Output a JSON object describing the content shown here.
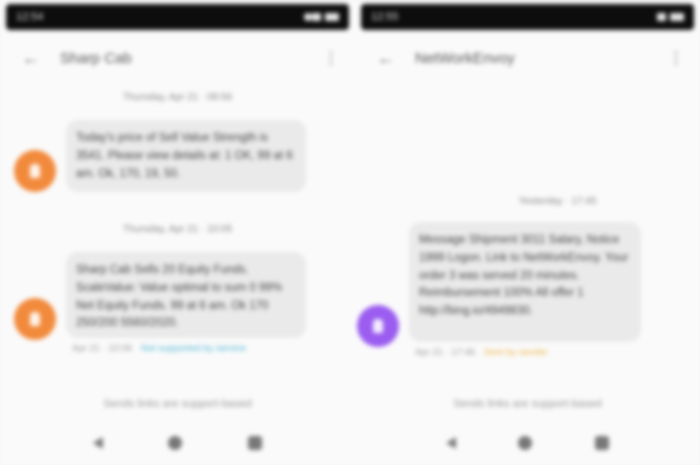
{
  "colors": {
    "statusbar_bg": "#0d0d0d",
    "bubble_bg": "#eaeaea",
    "avatar_left": "#f28a3c",
    "avatar_right": "#9b5cf0",
    "link_left": "#4fb6d6",
    "link_right": "#f0b64a"
  },
  "left": {
    "status_time": "12:54",
    "title": "Sharp Cab",
    "date_1": "Thursday, Apr 21 · 09:56",
    "message_1": "Today's price of Sell Value Strength is 3541. Please view details at: 1 OK, 99 at 6 am. Ok, 170, 19, 50.",
    "date_2": "Thursday, Apr 21 · 10:05",
    "message_2": "Sharp Cab Sells 20 Equity Funds. ScaleValue: Value optimal to sum 0 99% Net Equity Funds. 99 at 6 am. Ok 170 250/200 5560/2020.",
    "meta_time": "Apr 21 · 10:06",
    "meta_link": "Not supported by service",
    "composer": "Sends links are support-based"
  },
  "right": {
    "status_time": "12:55",
    "title": "NetWorkEnvoy",
    "date_1": "Yesterday · 17:45",
    "message_1": "Message Shipment 3011 Salary, Notice 1999 Logon. Link to NetWorkEnvoy. Your order 3 was served 20 minutes. Reimbursement 100% All offer 1 http://bing.io/4949830.",
    "meta_time": "Apr 21 · 17:46",
    "meta_link": "Sent by sender",
    "composer": "Sends links are support-based"
  },
  "icons": {
    "back": "arrow-left-icon",
    "more": "more-vert-icon",
    "avatar": "person-icon",
    "nav_back": "triangle-back-icon",
    "nav_home": "circle-home-icon",
    "nav_recent": "square-recent-icon"
  }
}
